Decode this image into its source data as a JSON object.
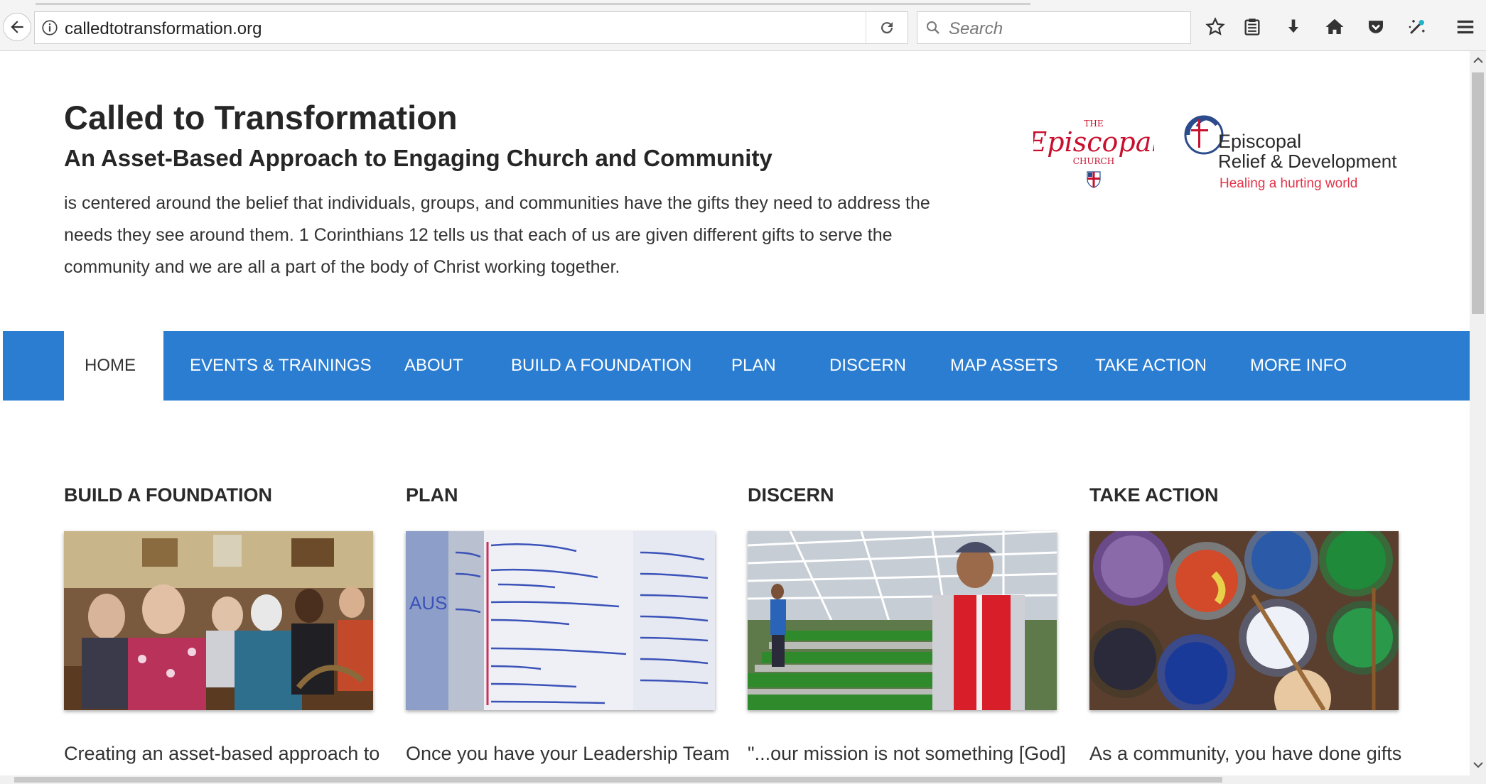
{
  "browser": {
    "url": "calledtotransformation.org",
    "search_placeholder": "Search"
  },
  "site": {
    "title": "Called to Transformation",
    "subtitle": "An Asset-Based Approach to Engaging Church and Community",
    "intro": "is centered around the belief that individuals, groups, and communities have the gifts they need to address the needs they see around them. 1 Corinthians 12 tells us that each of us are given different gifts to serve the community and we are all a part of the body of Christ working together."
  },
  "logos": {
    "episcopal_church": {
      "the": "THE",
      "name": "Episcopal",
      "church": "CHURCH"
    },
    "erd": {
      "line1": "Episcopal",
      "line2": "Relief & Development",
      "tagline": "Healing a hurting world"
    }
  },
  "nav": [
    {
      "label": "HOME",
      "active": true
    },
    {
      "label": "EVENTS & TRAININGS",
      "active": false
    },
    {
      "label": "ABOUT",
      "active": false
    },
    {
      "label": "BUILD A FOUNDATION",
      "active": false
    },
    {
      "label": "PLAN",
      "active": false
    },
    {
      "label": "DISCERN",
      "active": false
    },
    {
      "label": "MAP ASSETS",
      "active": false
    },
    {
      "label": "TAKE ACTION",
      "active": false
    },
    {
      "label": "MORE INFO",
      "active": false
    }
  ],
  "cards": [
    {
      "title": "BUILD A FOUNDATION",
      "text": "Creating an asset-based approach to"
    },
    {
      "title": "PLAN",
      "text": "Once you have your Leadership Team"
    },
    {
      "title": "DISCERN",
      "text": "\"...our mission is not something [God]"
    },
    {
      "title": "TAKE ACTION",
      "text": "As a community, you have done gifts"
    }
  ],
  "colors": {
    "nav_bg": "#2a7dd1",
    "erd_tagline": "#e0344a",
    "ec_red": "#c8102e"
  }
}
